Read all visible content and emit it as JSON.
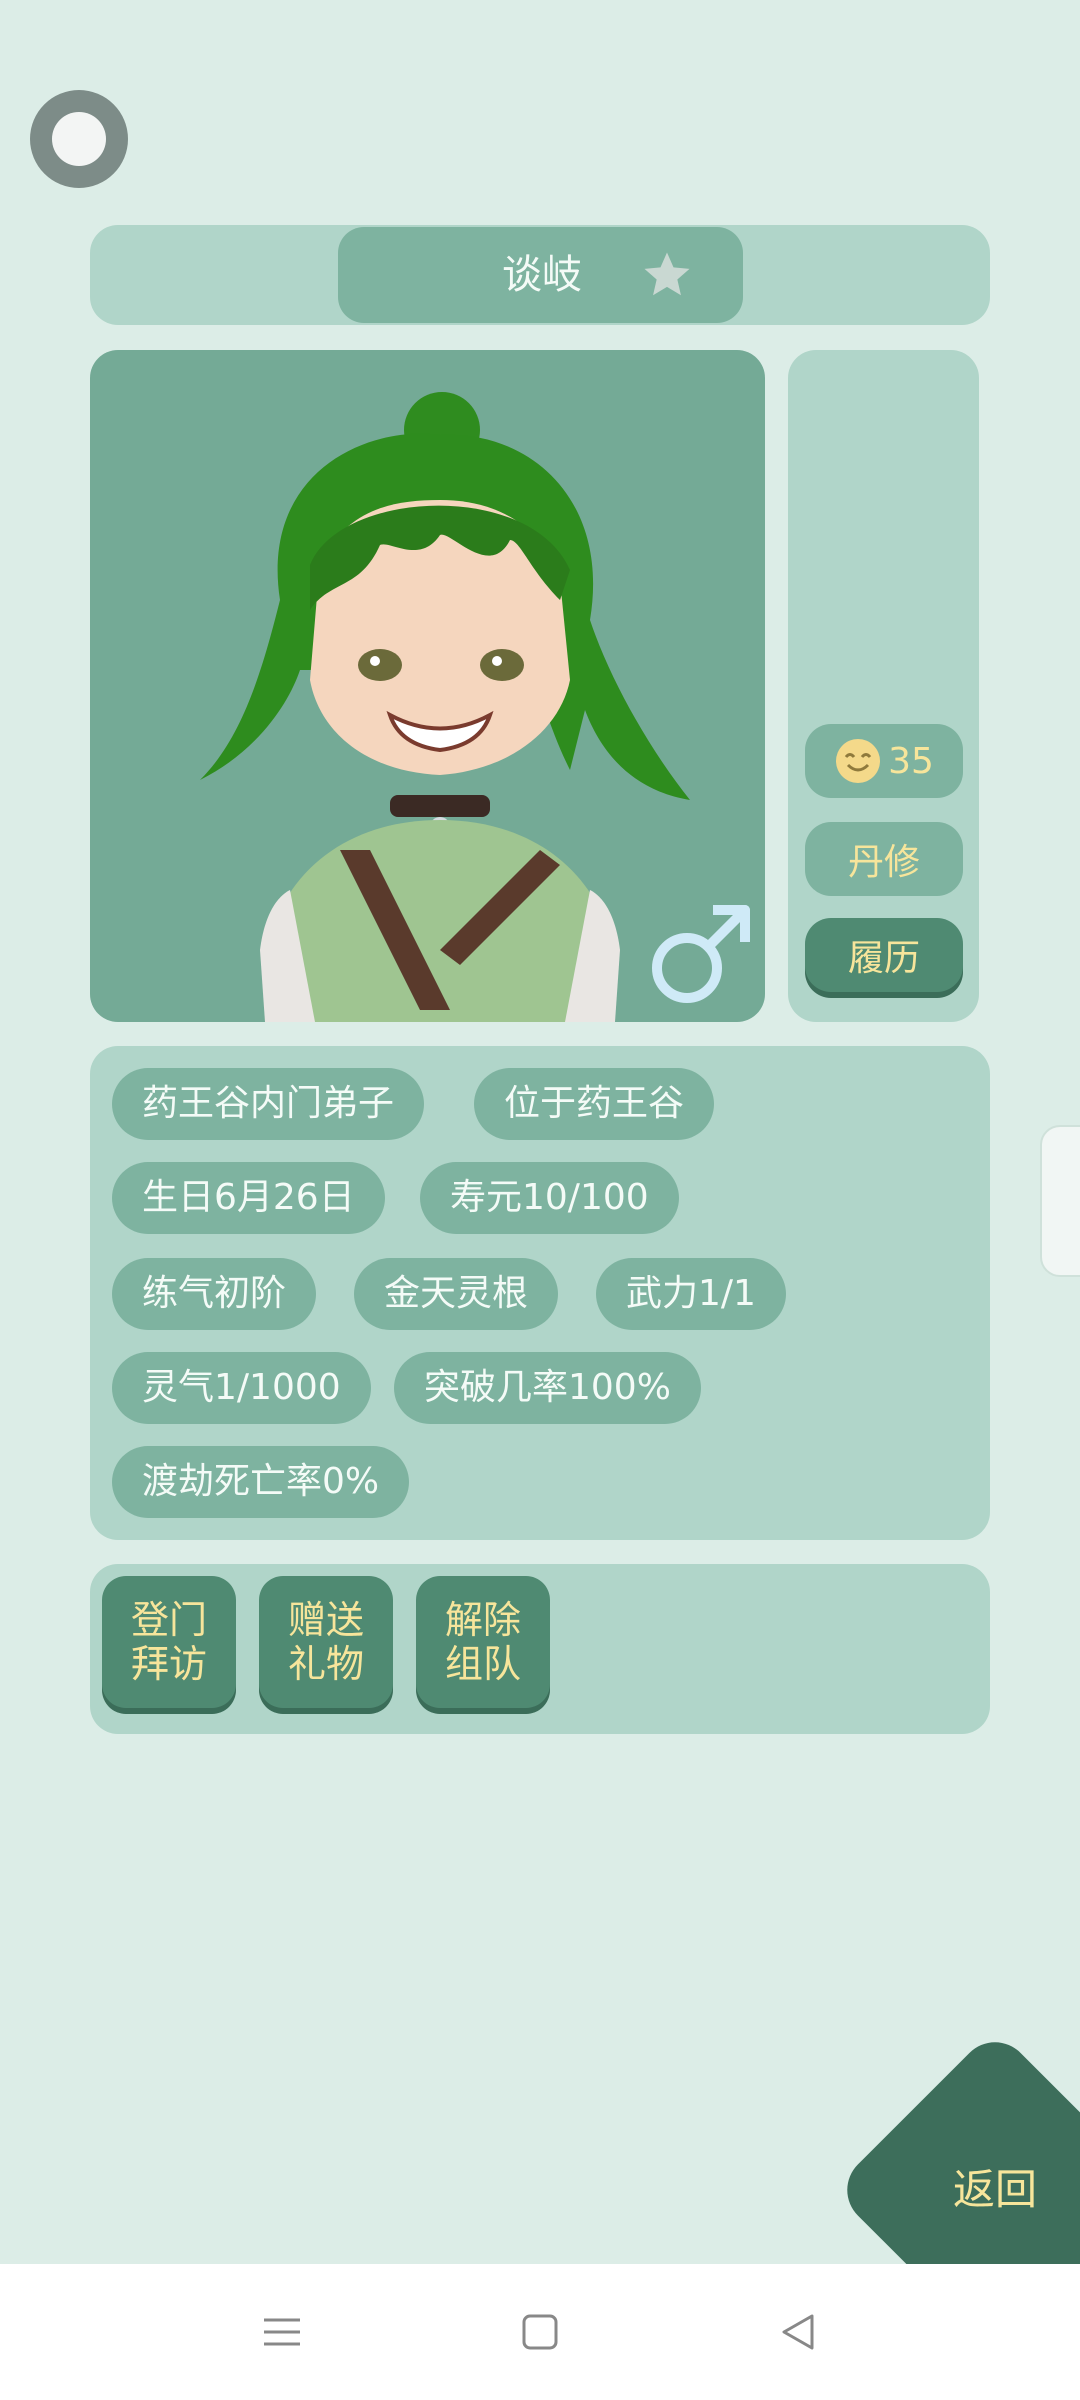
{
  "profile": {
    "name": "谈岐",
    "mood_value": "35",
    "profession": "丹修",
    "history_label": "履历"
  },
  "tags": [
    "药王谷内门弟子",
    "位于药王谷",
    "生日6月26日",
    "寿元10/100",
    "练气初阶",
    "金天灵根",
    "武力1/1",
    "灵气1/1000",
    "突破几率100%",
    "渡劫死亡率0%"
  ],
  "actions": [
    {
      "line1": "登门",
      "line2": "拜访"
    },
    {
      "line1": "赠送",
      "line2": "礼物"
    },
    {
      "line1": "解除",
      "line2": "组队"
    }
  ],
  "back_label": "返回",
  "icons": {
    "menu": "circle-menu-icon",
    "favorite": "star-icon",
    "gender": "male-symbol-icon",
    "mood": "smile-face-icon"
  },
  "colors": {
    "background": "#dcede7",
    "panel": "#b0d5c9",
    "chip": "#7eb3a0",
    "button_dark": "#4f8a72",
    "accent_text": "#f7e59b",
    "hair": "#2e8c1e"
  }
}
